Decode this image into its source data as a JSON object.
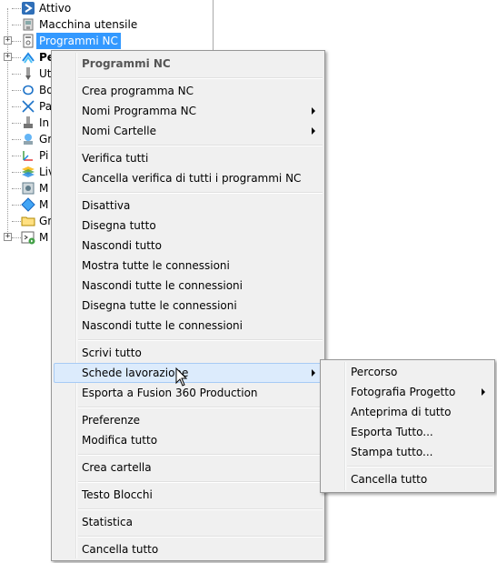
{
  "tree": {
    "items": [
      {
        "label": "Attivo",
        "icon": "attivo-icon"
      },
      {
        "label": "Macchina utensile",
        "icon": "machine-tool-icon"
      },
      {
        "label": "Programmi NC",
        "icon": "nc-program-icon"
      },
      {
        "label": "Pe",
        "icon": "toolpath-icon"
      },
      {
        "label": "Ut",
        "icon": "tool-icon"
      },
      {
        "label": "Bo",
        "icon": "boundary-icon"
      },
      {
        "label": "Pa",
        "icon": "pattern-icon"
      },
      {
        "label": "In",
        "icon": "feature-icon"
      },
      {
        "label": "Gr",
        "icon": "group-icon"
      },
      {
        "label": "Pi",
        "icon": "workplane-icon"
      },
      {
        "label": "Liv",
        "icon": "levels-icon"
      },
      {
        "label": "M",
        "icon": "model-icon"
      },
      {
        "label": "M",
        "icon": "stock-model-icon"
      },
      {
        "label": "Gr",
        "icon": "folder-icon"
      },
      {
        "label": "M",
        "icon": "macro-icon"
      }
    ]
  },
  "context_menu": {
    "header": "Programmi NC",
    "items": [
      {
        "label": "Crea programma NC"
      },
      {
        "label": "Nomi Programma NC",
        "submenu": true
      },
      {
        "label": "Nomi Cartelle",
        "submenu": true
      },
      {
        "label": "Verifica tutti"
      },
      {
        "label": "Cancella verifica di tutti i programmi NC"
      },
      {
        "label": "Disattiva"
      },
      {
        "label": "Disegna tutto"
      },
      {
        "label": "Nascondi tutto"
      },
      {
        "label": "Mostra tutte le connessioni"
      },
      {
        "label": "Nascondi tutte le connessioni"
      },
      {
        "label": "Disegna tutte le connessioni"
      },
      {
        "label": "Nascondi tutte le connessioni"
      },
      {
        "label": "Scrivi tutto"
      },
      {
        "label": "Schede lavorazione",
        "submenu": true
      },
      {
        "label": "Esporta a Fusion 360 Production"
      },
      {
        "label": "Preferenze"
      },
      {
        "label": "Modifica tutto"
      },
      {
        "label": "Crea cartella"
      },
      {
        "label": "Testo Blocchi"
      },
      {
        "label": "Statistica"
      },
      {
        "label": "Cancella tutto"
      }
    ]
  },
  "submenu": {
    "items": [
      {
        "label": "Percorso"
      },
      {
        "label": "Fotografia Progetto",
        "submenu": true
      },
      {
        "label": "Anteprima di tutto"
      },
      {
        "label": "Esporta Tutto..."
      },
      {
        "label": "Stampa tutto..."
      },
      {
        "label": "Cancella tutto"
      }
    ]
  },
  "colors": {
    "selection": "#3399ff",
    "menu_bg": "#f0f0f0",
    "hover": "#dcebfc"
  }
}
